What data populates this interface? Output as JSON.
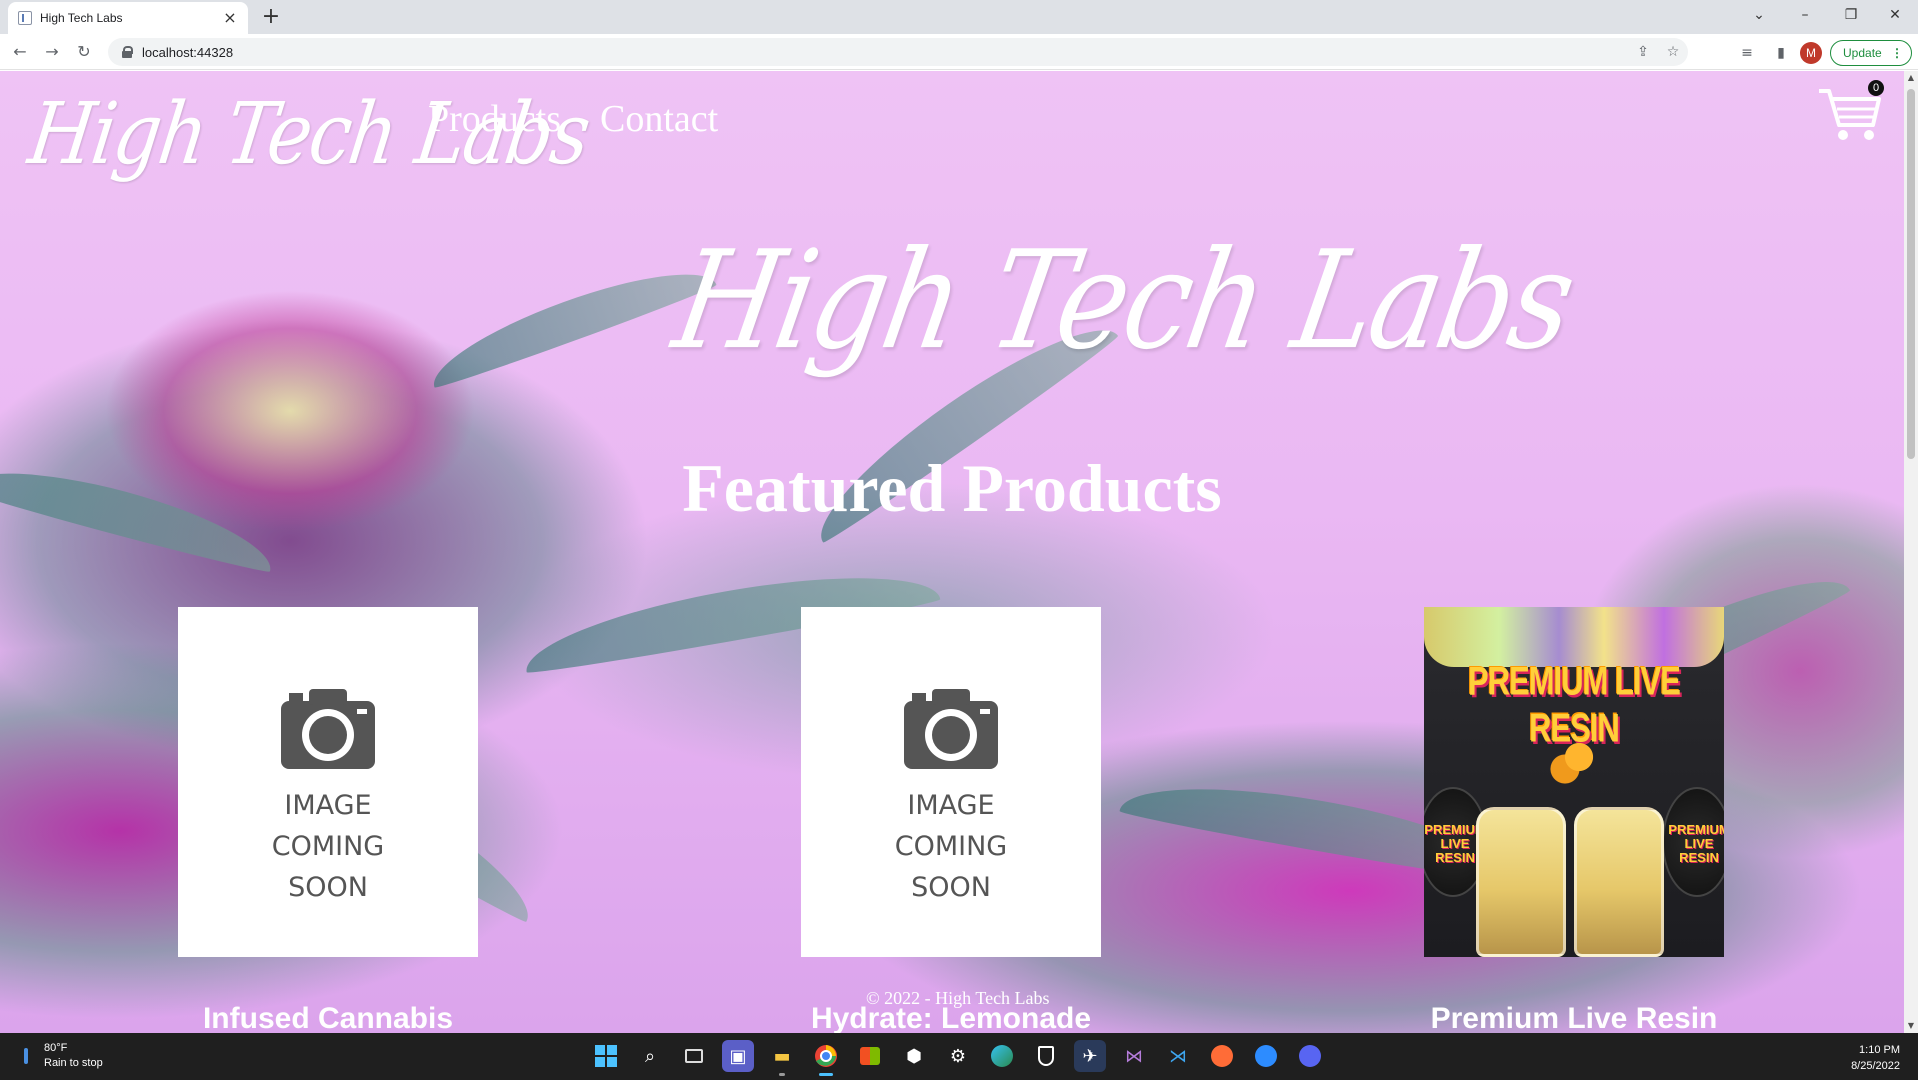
{
  "browser": {
    "tab_title": "High Tech Labs",
    "tab_close": "×",
    "new_tab": "+",
    "url": "localhost:44328",
    "profile_initial": "M",
    "update_label": "Update"
  },
  "site": {
    "brand": "High Tech Labs",
    "nav": [
      "Products",
      "Contact"
    ],
    "cart_count": "0",
    "hero_title": "High Tech Labs",
    "section_title": "Featured Products",
    "products": [
      {
        "title": "Infused Cannabis",
        "image": "placeholder",
        "placeholder_text": "IMAGE COMING SOON"
      },
      {
        "title": "Hydrate: Lemonade",
        "image": "placeholder",
        "placeholder_text": "IMAGE COMING SOON"
      },
      {
        "title": "Premium Live Resin",
        "image": "photo",
        "photo_label": "PREMIUM LIVE RESIN",
        "lid_label": "PREMIUM LIVE RESIN"
      }
    ],
    "footer": "© 2022 - High Tech Labs"
  },
  "taskbar": {
    "weather_temp": "80°F",
    "weather_desc": "Rain to stop",
    "time": "1:10 PM",
    "date": "8/25/2022",
    "apps": [
      "windows-icon",
      "search-icon",
      "task-view-icon",
      "teams-chat-icon",
      "file-explorer-icon",
      "chrome-icon",
      "store-icon",
      "github-icon",
      "settings-icon",
      "edge-icon",
      "bitwarden-icon",
      "ssms-icon",
      "visual-studio-icon",
      "vscode-icon",
      "postman-icon",
      "zoom-icon",
      "discord-icon"
    ]
  },
  "colors": {
    "accent_green": "#1e8e3e",
    "page_pink": "#efc3f5",
    "taskbar_bg": "#1f1f1f"
  }
}
